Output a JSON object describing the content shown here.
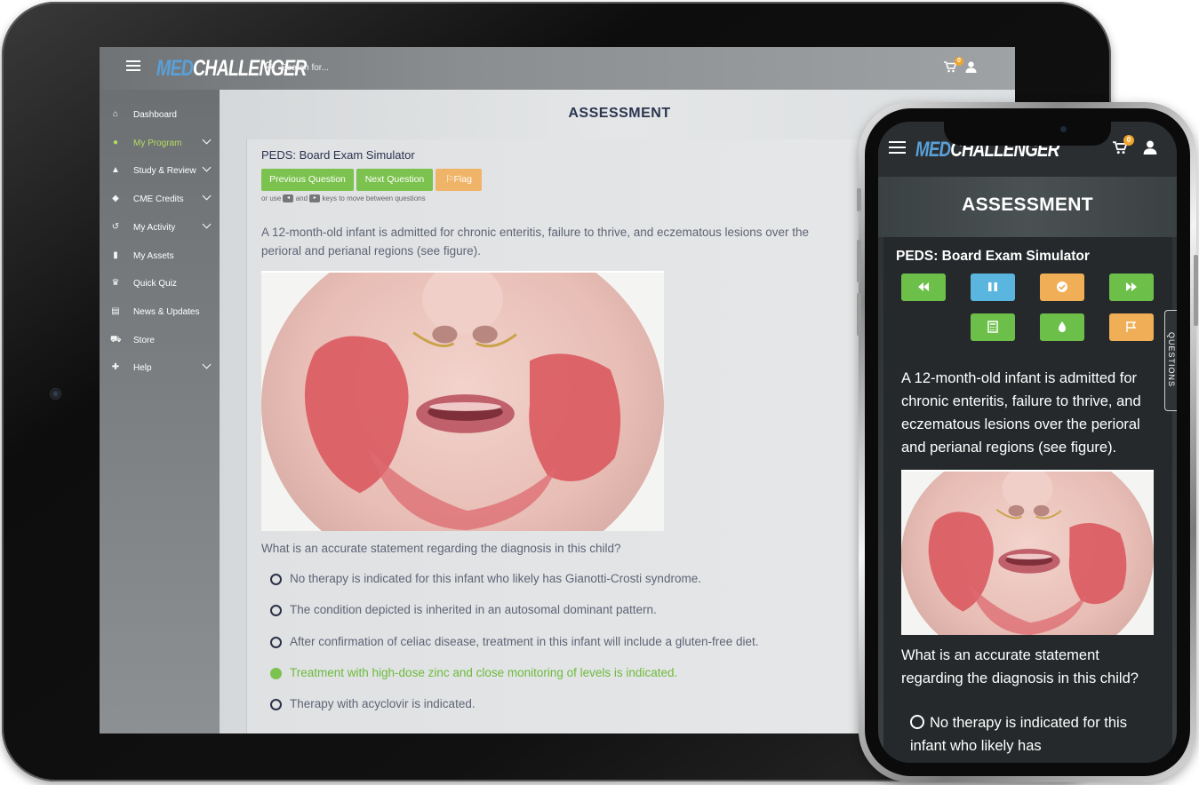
{
  "brand": {
    "logo_part1": "MED",
    "logo_part2": "CHALLENGER"
  },
  "tablet": {
    "search": {
      "placeholder": "Search for..."
    },
    "cart_count": "0",
    "sidebar": {
      "items": [
        {
          "label": "Dashboard",
          "icon": "home-icon",
          "chevron": false,
          "active": false
        },
        {
          "label": "My Program",
          "icon": "users-icon",
          "chevron": true,
          "active": true
        },
        {
          "label": "Study & Review",
          "icon": "graduation-cap-icon",
          "chevron": true,
          "active": false
        },
        {
          "label": "CME Credits",
          "icon": "certificate-icon",
          "chevron": true,
          "active": false
        },
        {
          "label": "My Activity",
          "icon": "history-icon",
          "chevron": true,
          "active": false
        },
        {
          "label": "My Assets",
          "icon": "bookmark-icon",
          "chevron": false,
          "active": false
        },
        {
          "label": "Quick Quiz",
          "icon": "trophy-icon",
          "chevron": false,
          "active": false
        },
        {
          "label": "News & Updates",
          "icon": "newspaper-icon",
          "chevron": false,
          "active": false
        },
        {
          "label": "Store",
          "icon": "cart-icon",
          "chevron": false,
          "active": false
        },
        {
          "label": "Help",
          "icon": "ambulance-icon",
          "chevron": true,
          "active": false
        }
      ]
    },
    "page_title": "ASSESSMENT",
    "exam_title": "PEDS: Board Exam Simulator",
    "buttons": {
      "previous": "Previous Question",
      "next": "Next Question",
      "flag": "Flag"
    },
    "hint": {
      "prefix": "or use",
      "middle": "and",
      "suffix": "keys to move between questions"
    },
    "stem": "A 12-month-old infant is admitted for chronic enteritis, failure to thrive, and eczematous lesions over the perioral and perianal regions (see figure).",
    "question": "What is an accurate statement regarding the diagnosis in this child?",
    "options": [
      {
        "label": "No therapy is indicated for this infant who likely has Gianotti-Crosti syndrome.",
        "selected": false
      },
      {
        "label": "The condition depicted is inherited in an autosomal dominant pattern.",
        "selected": false
      },
      {
        "label": "After confirmation of celiac disease, treatment in this infant will include a gluten-free diet.",
        "selected": false
      },
      {
        "label": "Treatment with high-dose zinc and close monitoring of levels is indicated.",
        "selected": true
      },
      {
        "label": "Therapy with acyclovir is indicated.",
        "selected": false
      }
    ]
  },
  "phone": {
    "cart_count": "0",
    "page_title": "ASSESSMENT",
    "exam_title": "PEDS: Board Exam Simulator",
    "questions_tab": "QUESTIONS",
    "control_buttons": [
      {
        "icon": "backward-icon",
        "color": "#6cc04a"
      },
      {
        "icon": "pause-icon",
        "color": "#5ab6de"
      },
      {
        "icon": "check-circle-icon",
        "color": "#f0ae56"
      },
      {
        "icon": "forward-icon",
        "color": "#6cc04a"
      },
      {
        "icon": "calculator-icon",
        "color": "#6cc04a"
      },
      {
        "icon": "tint-icon",
        "color": "#6cc04a"
      },
      {
        "icon": "flag-icon",
        "color": "#f0ae56"
      }
    ],
    "stem": "A 12-month-old infant is admitted for chronic enteritis, failure to thrive, and eczematous lesions over the perioral and perianal regions (see figure).",
    "question": "What is an accurate statement regarding the diagnosis in this child?",
    "first_option": "No therapy is indicated for this infant who likely has"
  },
  "colors": {
    "accent_green": "#7cc24f",
    "flag_orange": "#f0b468",
    "title_navy": "#2c3550",
    "logo_blue": "#5aa0d8"
  }
}
